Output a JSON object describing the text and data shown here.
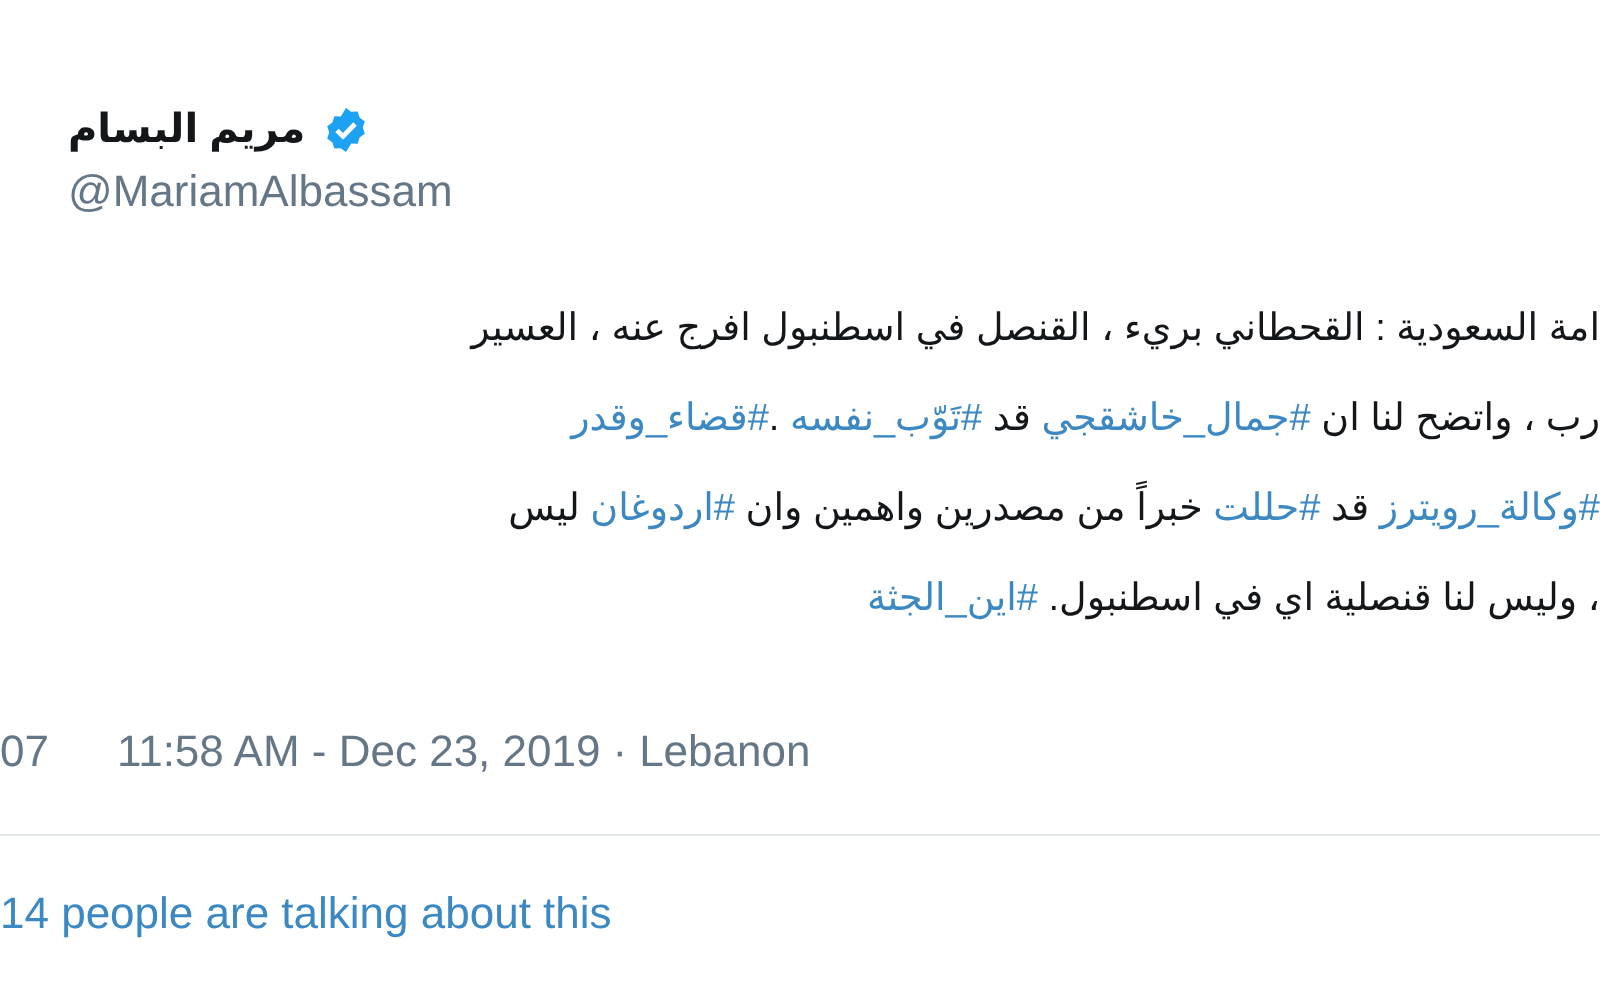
{
  "author": {
    "name": "مريم البسام",
    "verified": true,
    "handle": "@MariamAlbassam"
  },
  "tweet": {
    "lines": [
      [
        {
          "kind": "text",
          "text": "امة السعودية : القحطاني بريء ، القنصل في اسطنبول افرج عنه ، العسير"
        }
      ],
      [
        {
          "kind": "text",
          "text": "رب ، واتضح لنا ان "
        },
        {
          "kind": "hashtag",
          "text": "#جمال_خاشقجي"
        },
        {
          "kind": "text",
          "text": " قد "
        },
        {
          "kind": "hashtag",
          "text": "#تَوّب_نفسه"
        },
        {
          "kind": "text",
          "text": " ."
        },
        {
          "kind": "hashtag",
          "text": "#قضاء_وقدر"
        }
      ],
      [
        {
          "kind": "hashtag",
          "text": "#وكالة_رويترز"
        },
        {
          "kind": "text",
          "text": " قد "
        },
        {
          "kind": "hashtag",
          "text": "#حللت"
        },
        {
          "kind": "text",
          "text": " خبراً من مصدرين واهمين وان "
        },
        {
          "kind": "hashtag",
          "text": "#اردوغان"
        },
        {
          "kind": "text",
          "text": " ليس"
        }
      ],
      [
        {
          "kind": "text",
          "text": "، وليس لنا قنصلية اي في اسطنبول. "
        },
        {
          "kind": "hashtag",
          "text": "#اين_الجثة"
        }
      ]
    ]
  },
  "meta": {
    "count_fragment": "07",
    "timestamp": "11:58 AM - Dec 23, 2019",
    "separator": "·",
    "location": "Lebanon"
  },
  "talking": "14 people are talking about this"
}
